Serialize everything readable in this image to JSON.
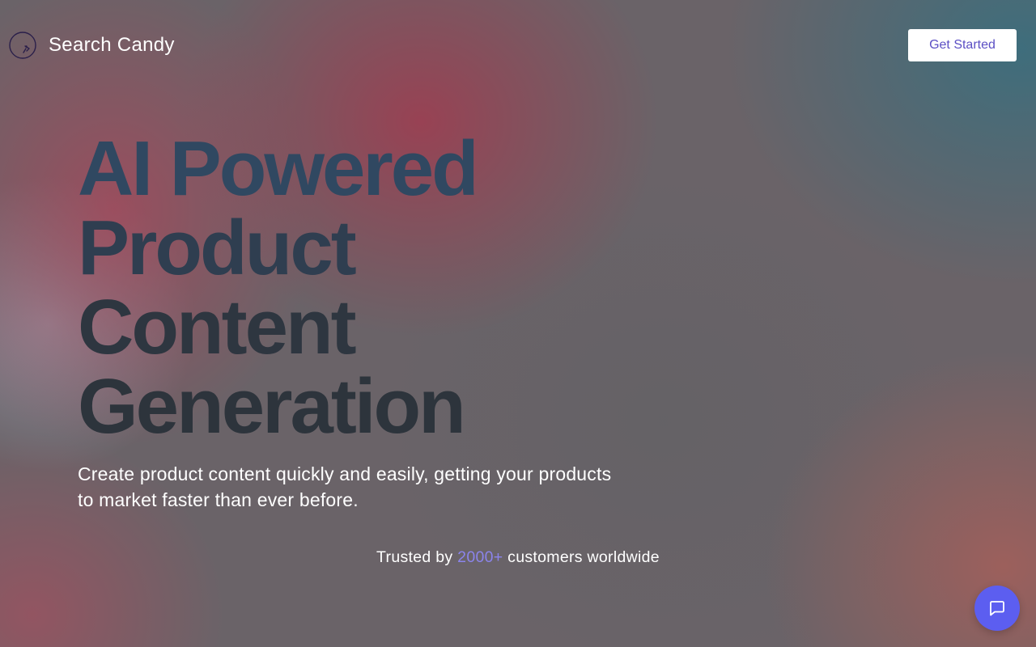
{
  "nav": {
    "logo_icon": "candy-circle-logo-icon",
    "brand_name": "Search Candy",
    "cta_label": "Get Started"
  },
  "hero": {
    "title_lines": [
      "AI Powered",
      "Product",
      "Content",
      "Generation"
    ],
    "subtitle": "Create product content quickly and easily, getting your products to market faster than ever before."
  },
  "trust": {
    "prefix": "Trusted by",
    "highlight": "2000+",
    "suffix": "customers worldwide"
  },
  "chat": {
    "icon": "chat-bubble-icon"
  },
  "colors": {
    "accent": "#8b84ec",
    "chat_button": "#5c5ef0",
    "cta_text": "#5b4fc4",
    "title_text": "#2f3d4e",
    "logo_stroke": "#2a1f4a"
  }
}
